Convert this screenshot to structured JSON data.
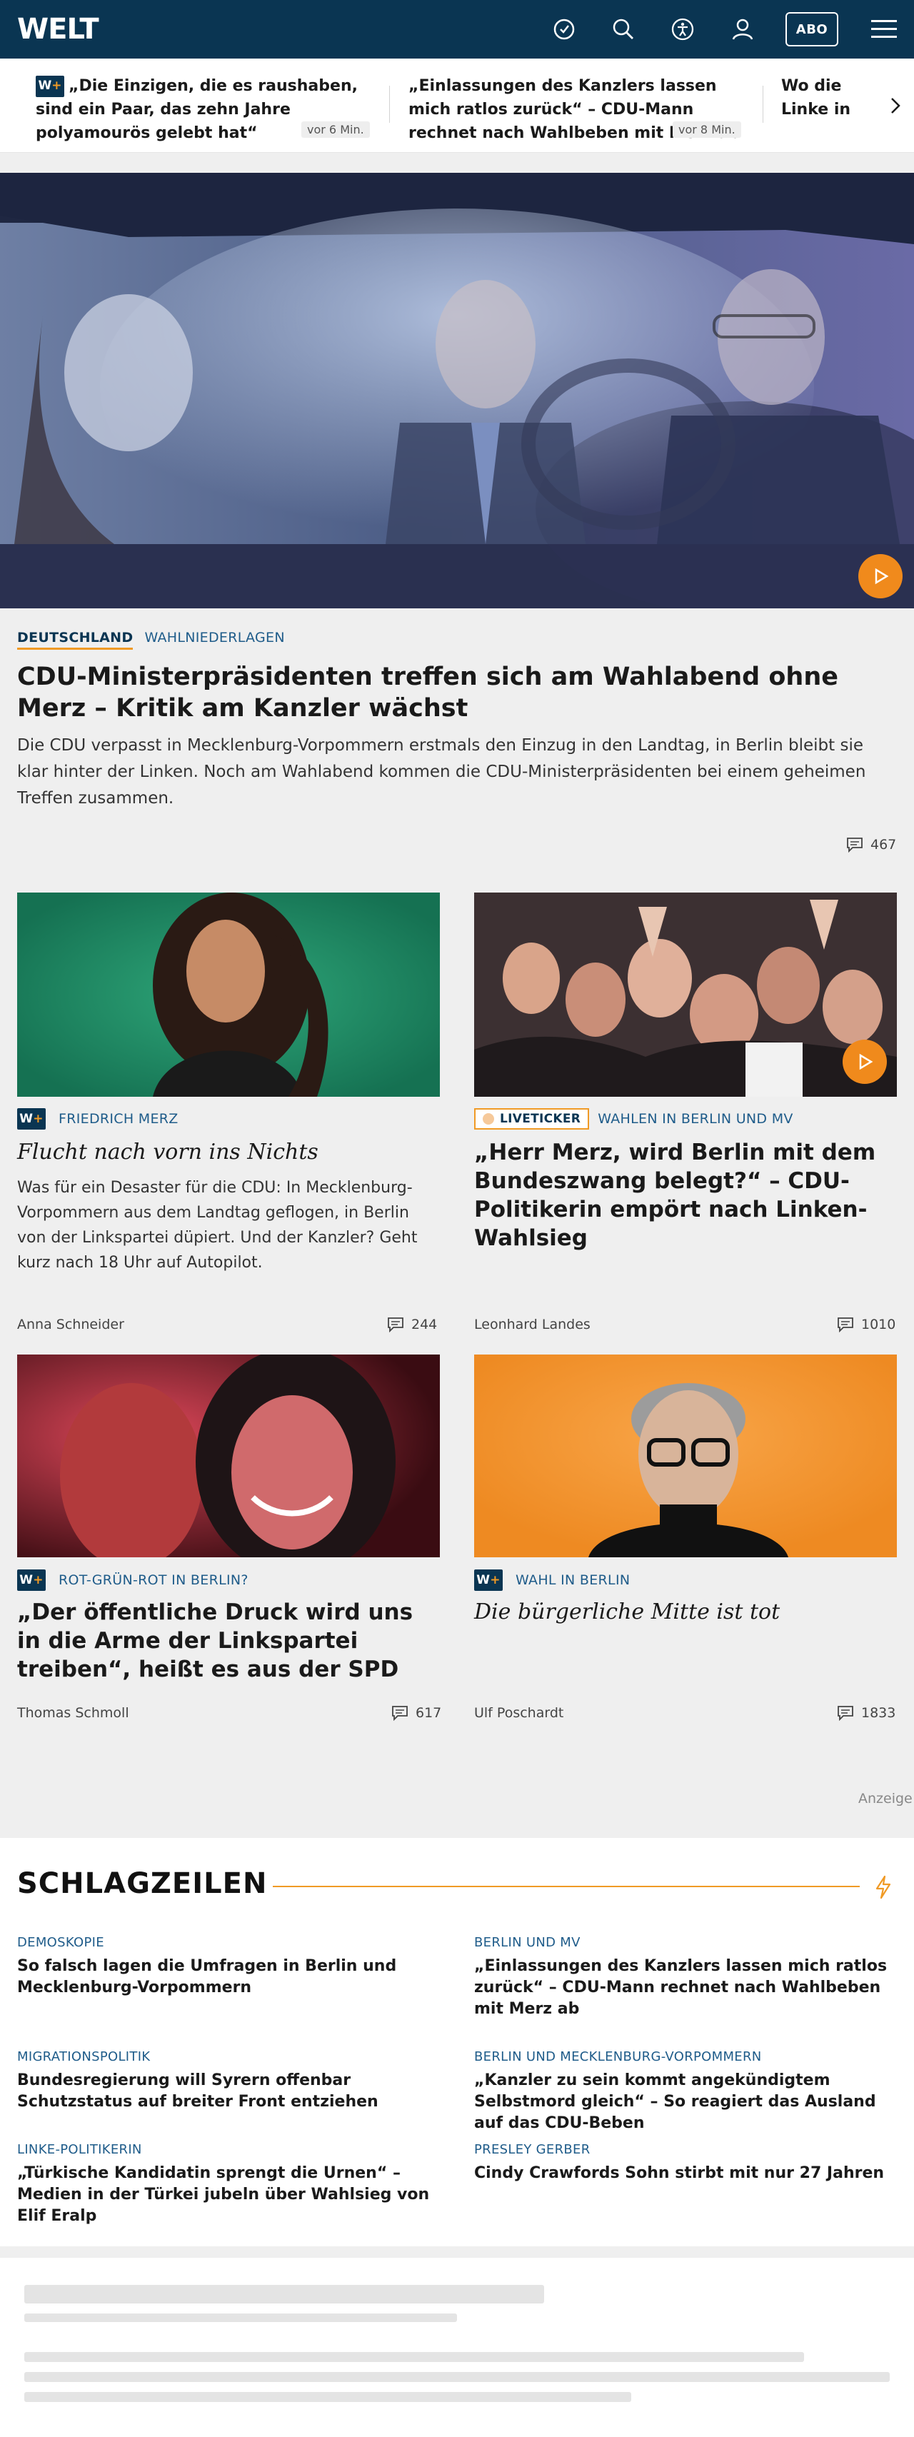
{
  "header": {
    "logo": "WELT",
    "abo_label": "ABO",
    "icons": [
      "history-icon",
      "search-icon",
      "accessibility-icon",
      "user-icon",
      "menu-icon"
    ]
  },
  "teaser_bar": {
    "items": [
      {
        "premium": true,
        "title": "„Die Einzigen, die es raushaben, sind ein Paar, das zehn Jahre polyamourös ge­lebt hat“",
        "time": "vor 6 Min."
      },
      {
        "premium": false,
        "title": "„Einlassungen des Kanzlers lassen mich ratlos zurück“ – CDU-Mann rechnet nach Wahlbeben mit Merz ab",
        "time": "vor 8 Min."
      },
      {
        "premium": false,
        "title": "Wo die Linke in den Berlin",
        "time": ""
      }
    ]
  },
  "hero": {
    "tag": "DEUTSCHLAND",
    "subtag": "WAHLNIEDERLAGEN",
    "headline": "CDU-Ministerpräsidenten treffen sich am Wahlabend ohne Merz – Kritik am Kanzler wächst",
    "lead": "Die CDU verpasst in Mecklenburg-Vorpommern erstmals den Einzug in den Landtag, in Berlin bleibt sie klar hinter der Linken. Noch am Wahlabend kommen die CDU-Ministerpräsidenten bei einem geheimen Treffen zusammen.",
    "comments": "467"
  },
  "cards": [
    {
      "premium": true,
      "live": false,
      "tag": "FRIEDRICH MERZ",
      "headline": "Flucht nach vorn ins Nichts",
      "lead": "Was für ein Desaster für die CDU: In Mecklenburg-Vorpommern aus dem Landtag geflogen, in Berlin von der Linkspartei düpiert. Und der Kanzler? Geht kurz nach 18 Uhr auf Autopilot.",
      "author": "Anna Schneider",
      "comments": "244"
    },
    {
      "premium": false,
      "live": true,
      "live_label": "LIVETICKER",
      "tag": "WAHLEN IN BERLIN UND MV",
      "headline": "„Herr Merz, wird Berlin mit dem Bundeszwang belegt?“ – CDU-Politikerin empört nach Linken-Wahlsieg",
      "lead": "",
      "author": "Leonhard Landes",
      "comments": "1010"
    },
    {
      "premium": true,
      "live": false,
      "tag": "ROT-GRÜN-ROT IN BERLIN?",
      "headline": "„Der öffentliche Druck wird uns in die Arme der Linkspartei treiben“, heißt es aus der SPD",
      "lead": "",
      "author": "Thomas Schmoll",
      "comments": "617"
    },
    {
      "premium": true,
      "live": false,
      "tag": "WAHL IN BERLIN",
      "headline": "Die bürgerliche Mitte ist tot",
      "lead": "",
      "author": "Ulf Poschardt",
      "comments": "1833"
    }
  ],
  "ad_label": "Anzeige",
  "schlagzeilen": {
    "title": "SCHLAGZEILEN",
    "items": [
      {
        "kicker": "DEMOSKOPIE",
        "headline": "So falsch lagen die Umfragen in Berlin und Mecklenburg-Vorpommern"
      },
      {
        "kicker": "BERLIN UND MV",
        "headline": "„Einlassungen des Kanzlers lassen mich ratlos zurück“ – CDU-Mann rechnet nach Wahlbeben mit Merz ab"
      },
      {
        "kicker": "MIGRATIONSPOLITIK",
        "headline": "Bundesregierung will Syrern offenbar Schutzstatus auf breiter Front entziehen"
      },
      {
        "kicker": "BERLIN UND MECKLENBURG-VORPOMMERN",
        "headline": "„Kanzler zu sein kommt angekündigtem Selbstmord gleich“ – So reagiert das Ausland auf das CDU-Beben"
      },
      {
        "kicker": "LINKE-POLITIKERIN",
        "headline": "„Türkische Kandidatin sprengt die Urnen“ – Medien in der Türkei jubeln über Wahlsieg von Elif Eralp"
      },
      {
        "kicker": "PRESLEY GERBER",
        "headline": "Cindy Crawfords Sohn stirbt mit nur 27 Jahren"
      }
    ]
  },
  "colors": {
    "brand": "#0a3552",
    "accent": "#f09a25",
    "link": "#1f5c8a",
    "play": "#f08a1c"
  }
}
